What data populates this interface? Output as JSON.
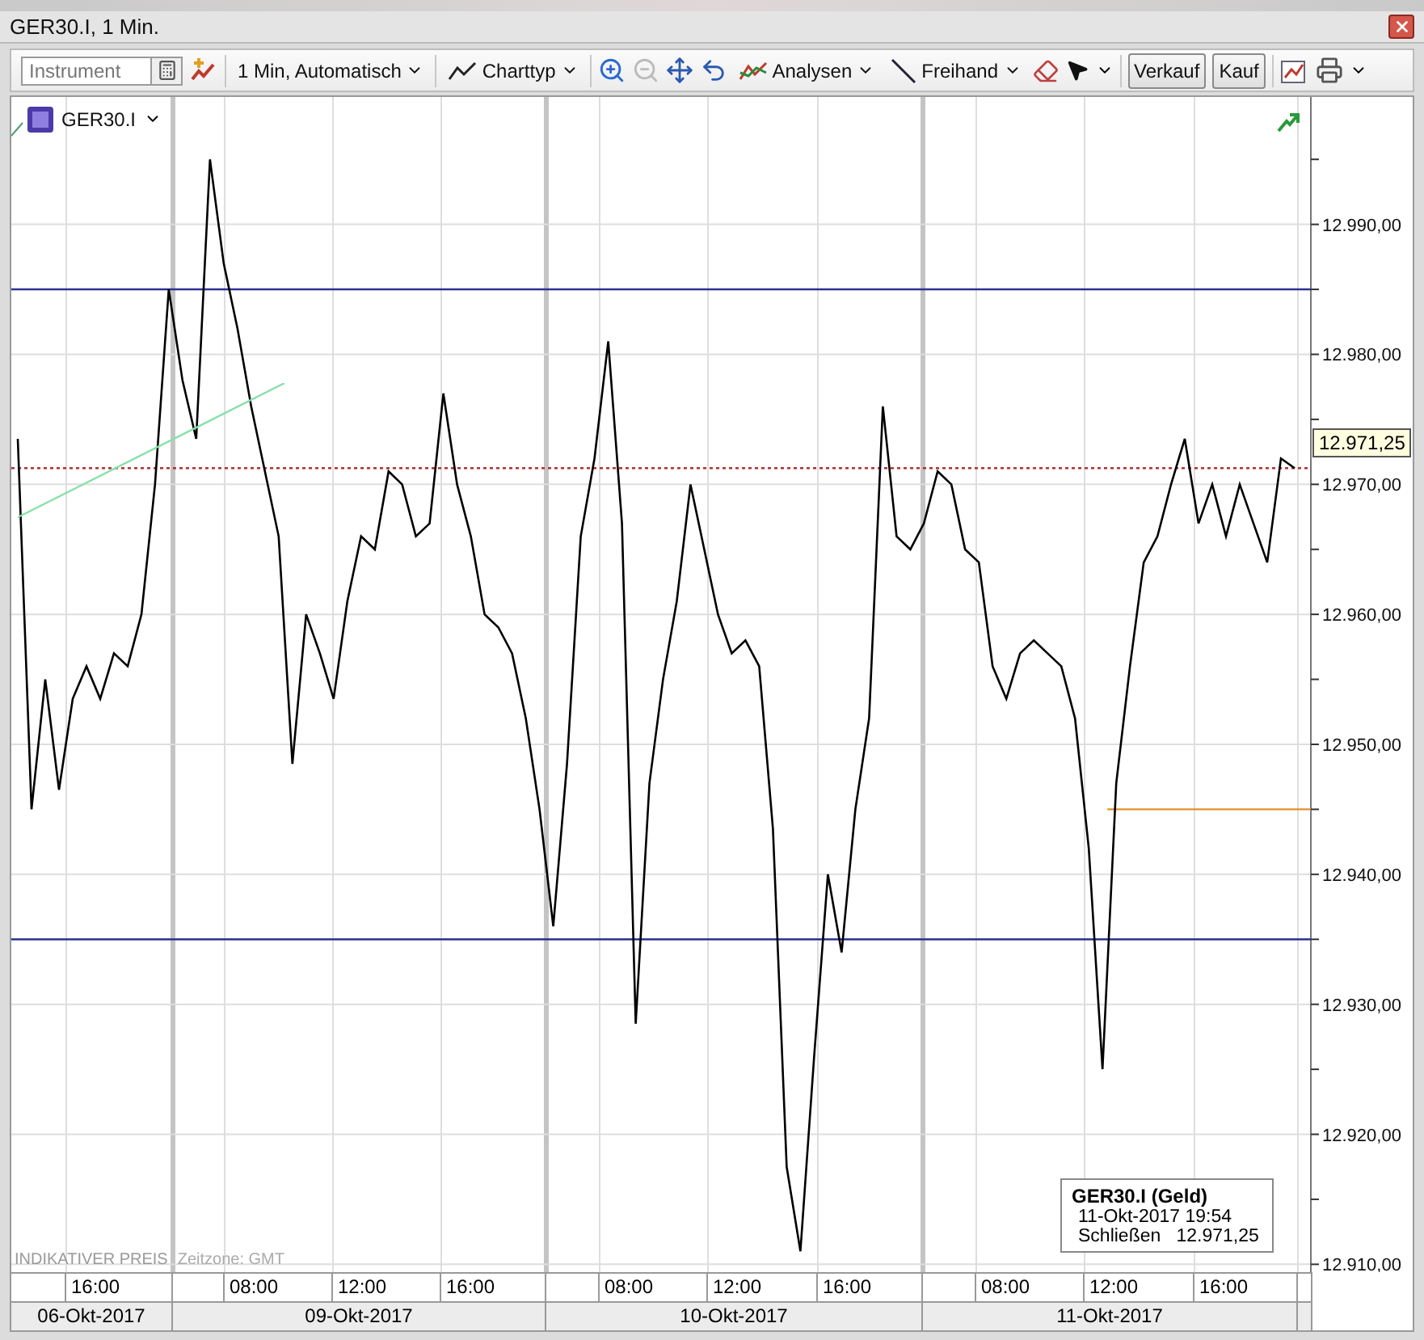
{
  "window": {
    "title": "GER30.I, 1 Min."
  },
  "toolbar": {
    "instrument": {
      "placeholder": "Instrument"
    },
    "interval": "1 Min,  Automatisch",
    "chart_type": "Charttyp",
    "analyses": "Analysen",
    "freehand": "Freihand",
    "sell": "Verkauf",
    "buy": "Kauf"
  },
  "chart": {
    "footer_label": "INDIKATIVER PREIS",
    "timezone": "Zeitzone: GMT",
    "price_tag": "12.971,25",
    "info": {
      "title": "GER30.I (Geld)",
      "time": "11-Okt-2017 19:54",
      "close_label": "Schließen",
      "close_value": "12.971,25"
    },
    "chart_data": {
      "type": "line",
      "grid": true,
      "ylim": [
        12909.4,
        12999.8
      ],
      "yticks": [
        {
          "value": 12910,
          "label": "12.910,00"
        },
        {
          "value": 12920,
          "label": "12.920,00"
        },
        {
          "value": 12930,
          "label": "12.930,00"
        },
        {
          "value": 12940,
          "label": "12.940,00"
        },
        {
          "value": 12950,
          "label": "12.950,00"
        },
        {
          "value": 12960,
          "label": "12.960,00"
        },
        {
          "value": 12970,
          "label": "12.970,00"
        },
        {
          "value": 12980,
          "label": "12.980,00"
        },
        {
          "value": 12990,
          "label": "12.990,00"
        }
      ],
      "series": [
        {
          "name": "GER30.I",
          "color": "#000000",
          "values": [
            12973.5,
            12945,
            12955,
            12946.5,
            12953.5,
            12956,
            12953.5,
            12957,
            12956,
            12960,
            12970,
            12985,
            12978,
            12973.5,
            12995,
            12987,
            12982,
            12976,
            12971,
            12966,
            12948.5,
            12960,
            12957,
            12953.5,
            12961,
            12966,
            12965,
            12971,
            12970,
            12966,
            12967,
            12977,
            12970,
            12966,
            12960,
            12959,
            12957,
            12952,
            12945,
            12936,
            12948.5,
            12966,
            12972,
            12981,
            12967,
            12928.5,
            12947,
            12955,
            12961,
            12970,
            12965,
            12960,
            12957,
            12958,
            12956,
            12943.5,
            12917.5,
            12911,
            12926,
            12940,
            12934,
            12945,
            12952,
            12976,
            12966,
            12965,
            12967,
            12971,
            12970,
            12965,
            12964,
            12956,
            12953.5,
            12957,
            12958,
            12957,
            12956,
            12952,
            12942,
            12925,
            12947,
            12956,
            12964,
            12966,
            12970,
            12973.5,
            12967,
            12970,
            12966,
            12970,
            12967,
            12964,
            12972,
            12971.25
          ]
        }
      ],
      "ref_lines": [
        {
          "axis": "y",
          "value": 12985,
          "color": "#2e3192"
        },
        {
          "axis": "y",
          "value": 12935,
          "color": "#2e3192"
        },
        {
          "axis": "y",
          "value": 12945,
          "color": "#e0902a"
        },
        {
          "axis": "y",
          "value": 12971.25,
          "color": "#b03030"
        }
      ]
    }
  },
  "time_axis": {
    "hours": [
      "16:00",
      "08:00",
      "12:00",
      "16:00",
      "08:00",
      "12:00",
      "16:00",
      "08:00",
      "12:00",
      "16:00"
    ],
    "dates": [
      "06-Okt-2017",
      "09-Okt-2017",
      "10-Okt-2017",
      "11-Okt-2017"
    ]
  }
}
